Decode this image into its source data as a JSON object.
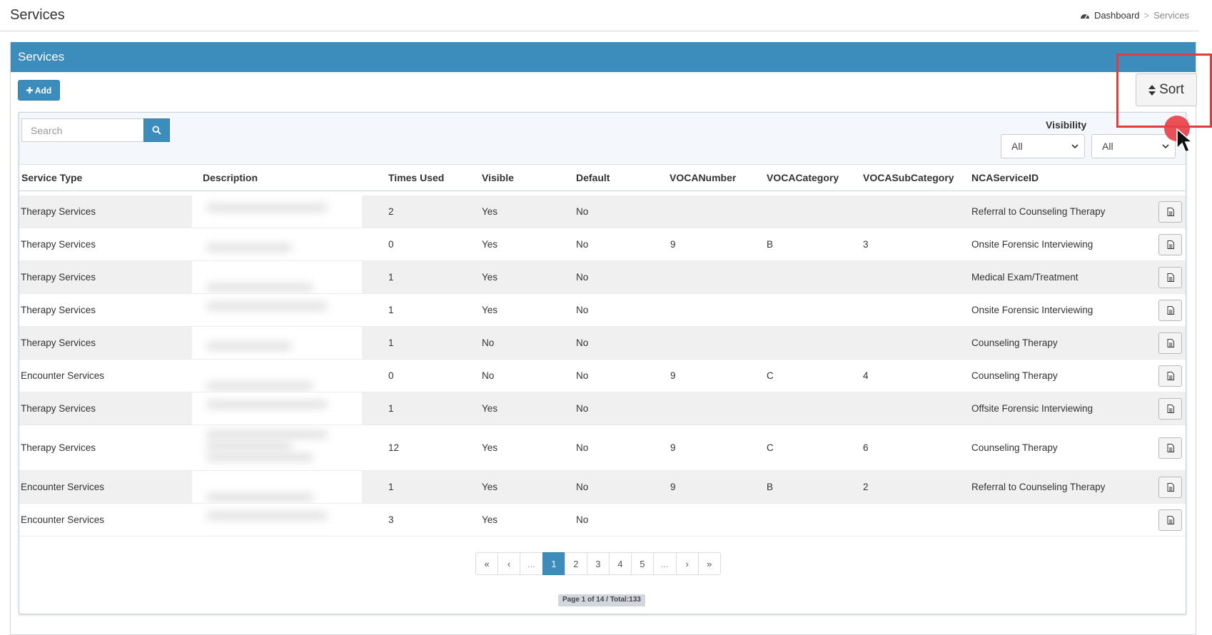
{
  "header": {
    "title": "Services",
    "breadcrumb": {
      "home": "Dashboard",
      "separator": ">",
      "current": "Services"
    }
  },
  "box": {
    "title": "Services",
    "add_label": "Add",
    "sort_label": "Sort"
  },
  "filters": {
    "search_placeholder": "Search",
    "visibility_label": "Visibility",
    "select_1_value": "All",
    "select_2_value": "All"
  },
  "table": {
    "columns": [
      "Service Type",
      "Description",
      "Times Used",
      "Visible",
      "Default",
      "VOCANumber",
      "VOCACategory",
      "VOCASubCategory",
      "NCAServiceID"
    ],
    "rows": [
      {
        "service_type": "Therapy Services",
        "times_used": "2",
        "visible": "Yes",
        "default": "No",
        "voca_number": "",
        "voca_category": "",
        "voca_subcategory": "",
        "nca_service_id": "Referral to Counseling Therapy"
      },
      {
        "service_type": "Therapy Services",
        "times_used": "0",
        "visible": "Yes",
        "default": "No",
        "voca_number": "9",
        "voca_category": "B",
        "voca_subcategory": "3",
        "nca_service_id": "Onsite Forensic Interviewing"
      },
      {
        "service_type": "Therapy Services",
        "times_used": "1",
        "visible": "Yes",
        "default": "No",
        "voca_number": "",
        "voca_category": "",
        "voca_subcategory": "",
        "nca_service_id": "Medical Exam/Treatment"
      },
      {
        "service_type": "Therapy Services",
        "times_used": "1",
        "visible": "Yes",
        "default": "No",
        "voca_number": "",
        "voca_category": "",
        "voca_subcategory": "",
        "nca_service_id": "Onsite Forensic Interviewing"
      },
      {
        "service_type": "Therapy Services",
        "times_used": "1",
        "visible": "No",
        "default": "No",
        "voca_number": "",
        "voca_category": "",
        "voca_subcategory": "",
        "nca_service_id": "Counseling Therapy"
      },
      {
        "service_type": "Encounter Services",
        "times_used": "0",
        "visible": "No",
        "default": "No",
        "voca_number": "9",
        "voca_category": "C",
        "voca_subcategory": "4",
        "nca_service_id": "Counseling Therapy"
      },
      {
        "service_type": "Therapy Services",
        "times_used": "1",
        "visible": "Yes",
        "default": "No",
        "voca_number": "",
        "voca_category": "",
        "voca_subcategory": "",
        "nca_service_id": "Offsite Forensic Interviewing"
      },
      {
        "service_type": "Therapy Services",
        "times_used": "12",
        "visible": "Yes",
        "default": "No",
        "voca_number": "9",
        "voca_category": "C",
        "voca_subcategory": "6",
        "nca_service_id": "Counseling Therapy"
      },
      {
        "service_type": "Encounter Services",
        "times_used": "1",
        "visible": "Yes",
        "default": "No",
        "voca_number": "9",
        "voca_category": "B",
        "voca_subcategory": "2",
        "nca_service_id": "Referral to Counseling Therapy"
      },
      {
        "service_type": "Encounter Services",
        "times_used": "3",
        "visible": "Yes",
        "default": "No",
        "voca_number": "",
        "voca_category": "",
        "voca_subcategory": "",
        "nca_service_id": ""
      }
    ]
  },
  "pagination": {
    "first": "«",
    "prev": "‹",
    "ellipsis_left": "...",
    "pages": [
      "1",
      "2",
      "3",
      "4",
      "5"
    ],
    "active_page": "1",
    "ellipsis_right": "...",
    "next": "›",
    "last": "»",
    "summary": "Page 1 of 14 / Total:133"
  },
  "icons": {
    "breadcrumb": "dashboard-icon",
    "add": "plus-icon",
    "sort": "sort-icon",
    "search": "search-icon",
    "row_action": "document-icon"
  },
  "colors": {
    "primary": "#3c8dbc",
    "highlight": "#e03c3c"
  }
}
